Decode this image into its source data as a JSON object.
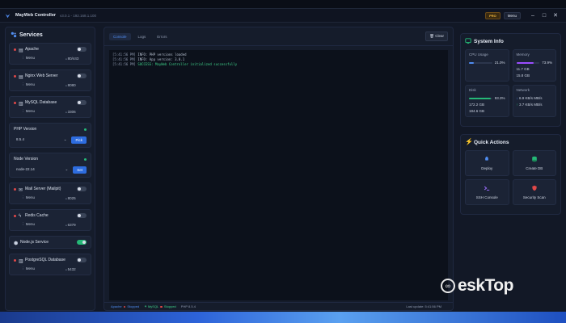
{
  "app": {
    "title": "MayWeb Controller",
    "version": "v3.0.1 - 192.168.1.100",
    "pro_label": "PRO",
    "menu_label": "Menu",
    "window_controls": [
      "–",
      "□",
      "✕"
    ]
  },
  "sidebar": {
    "title": "Services",
    "services": [
      {
        "name": "Apache",
        "menu": "Menu",
        "port": "80/443",
        "running": false
      },
      {
        "name": "Nginx Web Server",
        "menu": "Menu",
        "port": "8080",
        "running": false
      },
      {
        "name": "MySQL Database",
        "menu": "Menu",
        "port": "3306",
        "running": false
      }
    ],
    "php": {
      "title": "PHP Version",
      "selected": "8.5.4",
      "button": "Pick"
    },
    "node": {
      "title": "Node Version",
      "selected": "node-22.14",
      "button": "Set"
    },
    "services2": [
      {
        "name": "Mail Server (Mailpit)",
        "menu": "Menu",
        "port": "8025",
        "running": false
      },
      {
        "name": "Redis Cache",
        "menu": "Menu",
        "port": "6379",
        "running": false
      },
      {
        "name": "Node.js Service",
        "running": true
      },
      {
        "name": "PostgreSQL Database",
        "menu": "Menu",
        "port": "5432",
        "running": false
      }
    ]
  },
  "main": {
    "tabs": [
      "Console",
      "Logs",
      "Errors"
    ],
    "active_tab": "Console",
    "clear_label": "Clear",
    "logs": [
      {
        "ts": "[5:41:56 PM]",
        "text": "INFO: PHP versions loaded",
        "type": "info"
      },
      {
        "ts": "[5:41:56 PM]",
        "text": "INFO: App version: 3.0.1",
        "type": "info"
      },
      {
        "ts": "[5:41:56 PM]",
        "text": "SUCCESS: MayWeb Controller initialized successfully",
        "type": "success"
      }
    ],
    "status": {
      "apache": "Apache",
      "apache_state": "Stopped",
      "mysql": "MySQL",
      "mysql_state": "Stopped",
      "php": "PHP 8.5.4",
      "last_update": "Last update: 5:41:56 PM"
    }
  },
  "system_info": {
    "title": "System Info",
    "cpu": {
      "label": "CPU Usage",
      "percent": "21.0%",
      "fraction": 0.21
    },
    "memory": {
      "label": "Memory",
      "percent": "73.9%",
      "fraction": 0.739,
      "used": "11.7 GB",
      "total": "15.8 GB"
    },
    "disk": {
      "label": "Disk",
      "percent": "93.3%",
      "fraction": 0.933,
      "used": "172.2 GB",
      "total": "184.6 GB"
    },
    "network": {
      "label": "Network",
      "down": "6.9 KB/s MB/s",
      "up": "3.7 KB/s MB/s"
    }
  },
  "quick_actions": {
    "title": "Quick Actions",
    "items": [
      {
        "label": "Deploy",
        "icon": "rocket-icon"
      },
      {
        "label": "Create DB",
        "icon": "database-icon"
      },
      {
        "label": "SSH Console",
        "icon": "terminal-icon"
      },
      {
        "label": "Security Scan",
        "icon": "shield-icon"
      }
    ]
  },
  "watermark": {
    "text": "eskTop"
  },
  "colors": {
    "accent": "#2d6cdf",
    "success": "#25b877",
    "danger": "#e04848",
    "memory_bar": "#9b4dff",
    "disk_bar": "#25b877",
    "cpu_bar": "#4f8cf0"
  }
}
